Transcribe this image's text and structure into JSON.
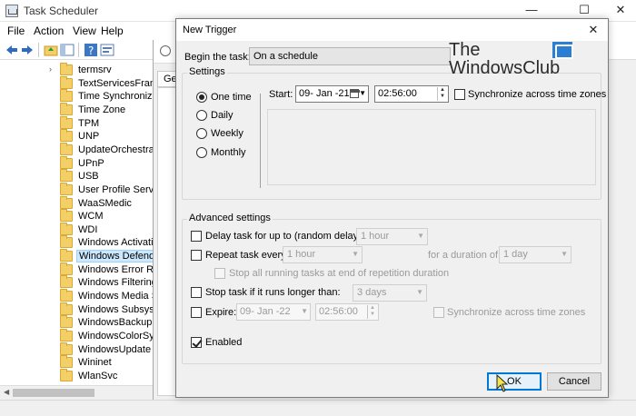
{
  "main_window": {
    "title": "Task Scheduler",
    "controls": {
      "minimize": "—",
      "maximize": "☐",
      "close": "✕"
    },
    "menu": [
      "File",
      "Action",
      "View",
      "Help"
    ],
    "tree_items": [
      "termsrv",
      "TextServicesFramework",
      "Time Synchronization",
      "Time Zone",
      "TPM",
      "UNP",
      "UpdateOrchestrator",
      "UPnP",
      "USB",
      "User Profile Service",
      "WaaSMedic",
      "WCM",
      "WDI",
      "Windows Activation",
      "Windows Defender",
      "Windows Error Reporting",
      "Windows Filtering Platform",
      "Windows Media Sharing",
      "Windows Subsystem",
      "WindowsBackup",
      "WindowsColorSystem",
      "WindowsUpdate",
      "Wininet",
      "WlanSvc"
    ],
    "selected_item": "Windows Defender",
    "background_tab": "Ge"
  },
  "dialog": {
    "title": "New Trigger",
    "close": "✕",
    "begin_label": "Begin the task:",
    "begin_value": "On a schedule",
    "settings": {
      "title": "Settings",
      "radios": [
        "One time",
        "Daily",
        "Weekly",
        "Monthly"
      ],
      "selected": "One time",
      "start_label": "Start:",
      "start_date": "09- Jan -21",
      "start_time": "02:56:00",
      "sync_label": "Synchronize across time zones"
    },
    "advanced": {
      "title": "Advanced settings",
      "delay_label": "Delay task for up to (random delay):",
      "delay_value": "1 hour",
      "repeat_label": "Repeat task every:",
      "repeat_value": "1 hour",
      "duration_label": "for a duration of:",
      "duration_value": "1 day",
      "stop_running_label": "Stop all running tasks at end of repetition duration",
      "stop_longer_label": "Stop task if it runs longer than:",
      "stop_longer_value": "3 days",
      "expire_label": "Expire:",
      "expire_date": "09- Jan -22",
      "expire_time": "02:56:00",
      "expire_sync_label": "Synchronize across time zones",
      "enabled_label": "Enabled"
    },
    "ok_label": "OK",
    "cancel_label": "Cancel"
  },
  "watermark": {
    "line1": "The",
    "line2": "WindowsClub"
  },
  "colors": {
    "accent": "#0078d7",
    "selection": "#cce8ff",
    "folder": "#f3cf67"
  }
}
